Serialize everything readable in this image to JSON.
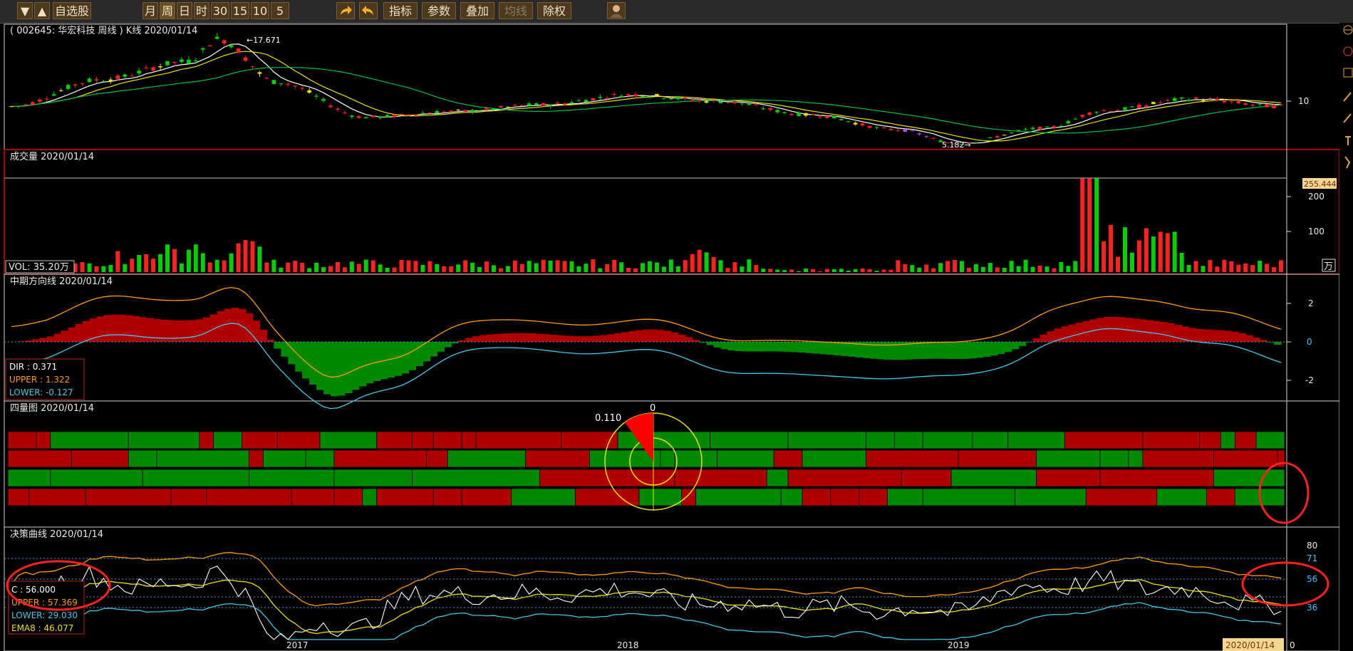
{
  "toolbar": {
    "nav": [
      "▼",
      "▲"
    ],
    "watchlist": "自选股",
    "periods": [
      "月",
      "周",
      "日",
      "时",
      "30",
      "15",
      "10",
      "5"
    ],
    "active_period": "周",
    "actions": [
      "指标",
      "参数",
      "叠加",
      "均线",
      "除权"
    ],
    "disabled_action": "均线",
    "icons": [
      "forward-arrow-icon",
      "back-arrow-icon",
      "avatar-icon"
    ]
  },
  "colors": {
    "up": "#ff2020",
    "down": "#00d000",
    "panel_border": "#e00000",
    "ma_white": "#ffffff",
    "ma_yellow": "#e8e000",
    "ma_green": "#00c040",
    "orange": "#ff9a00",
    "cyan": "#40c8e8",
    "fill_red": "#b00000",
    "fill_green": "#008a00"
  },
  "panels": {
    "kline": {
      "title": "( 002645: 华宏科技 周线 ) K线 2020/01/14",
      "high_label": "←17.671",
      "low_label": "5.182→",
      "axis_tick": "10"
    },
    "volume": {
      "title": "成交量 2020/01/14",
      "vol_label": "VOL: 35.20万",
      "axis_ticks": [
        "200",
        "100"
      ],
      "last_value": "255.444",
      "unit": "万"
    },
    "dir": {
      "title": "中期方向线 2020/01/14",
      "axis_ticks": [
        "2",
        "0",
        "-2"
      ],
      "legend": [
        "DIR      : 0.371",
        "UPPER : 1.322",
        "LOWER: -0.127"
      ]
    },
    "quad": {
      "title": "四量图 2020/01/14",
      "ring_labels": [
        "0.110",
        "0"
      ]
    },
    "decision": {
      "title": "决策曲线 2020/01/14",
      "axis_ticks": [
        "80",
        "71",
        "56",
        "36"
      ],
      "legend": [
        "C      : 56.000",
        "UPPER : 57.369",
        "LOWER: 29.030",
        "EMA8   : 46.077"
      ]
    }
  },
  "x_axis": {
    "ticks": [
      "2017",
      "2018",
      "2019"
    ],
    "date_box": "2020/01/14",
    "end_label": "0"
  },
  "chart_data": {
    "type": "candlestick",
    "title": "( 002645: 华宏科技 周线 ) K线 2020/01/14",
    "period": "weekly",
    "date_range": [
      "2016",
      "2020/01/14"
    ],
    "x_ticks": [
      "2017",
      "2018",
      "2019"
    ],
    "price_keypoints": [
      {
        "x": "2016-06",
        "close": 9.6
      },
      {
        "x": "2016-09",
        "close": 12.8
      },
      {
        "x": "2016-12",
        "close": 15.0
      },
      {
        "x": "2017-01",
        "close": 17.671
      },
      {
        "x": "2017-03",
        "close": 12.5
      },
      {
        "x": "2017-06",
        "close": 8.3
      },
      {
        "x": "2017-09",
        "close": 9.0
      },
      {
        "x": "2017-12",
        "close": 9.8
      },
      {
        "x": "2018-03",
        "close": 11.0
      },
      {
        "x": "2018-06",
        "close": 10.2
      },
      {
        "x": "2018-09",
        "close": 8.6
      },
      {
        "x": "2018-12",
        "close": 6.8
      },
      {
        "x": "2019-02",
        "close": 5.182
      },
      {
        "x": "2019-05",
        "close": 7.0
      },
      {
        "x": "2019-07",
        "close": 9.1
      },
      {
        "x": "2019-10",
        "close": 10.5
      },
      {
        "x": "2020-01",
        "close": 9.6
      }
    ],
    "price_high": 17.671,
    "price_low": 5.182,
    "volume_unit": "万",
    "volume_last": 35.2,
    "volume_axis_max": 255.444,
    "dir": {
      "DIR": 0.371,
      "UPPER": 1.322,
      "LOWER": -0.127,
      "ylim": [
        -3.2,
        3.2
      ]
    },
    "decision": {
      "C": 56.0,
      "UPPER": 57.369,
      "LOWER": 29.03,
      "EMA8": 46.077,
      "levels": [
        80,
        71,
        56,
        36
      ]
    },
    "quad_ring": {
      "value": 0.11,
      "zero": 0
    }
  }
}
